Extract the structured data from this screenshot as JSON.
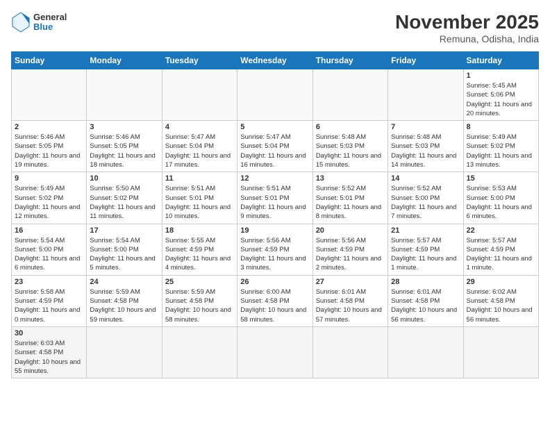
{
  "logo": {
    "general": "General",
    "blue": "Blue"
  },
  "title": "November 2025",
  "subtitle": "Remuna, Odisha, India",
  "days_of_week": [
    "Sunday",
    "Monday",
    "Tuesday",
    "Wednesday",
    "Thursday",
    "Friday",
    "Saturday"
  ],
  "weeks": [
    [
      {
        "day": "",
        "info": ""
      },
      {
        "day": "",
        "info": ""
      },
      {
        "day": "",
        "info": ""
      },
      {
        "day": "",
        "info": ""
      },
      {
        "day": "",
        "info": ""
      },
      {
        "day": "",
        "info": ""
      },
      {
        "day": "1",
        "info": "Sunrise: 5:45 AM\nSunset: 5:06 PM\nDaylight: 11 hours and 20 minutes."
      }
    ],
    [
      {
        "day": "2",
        "info": "Sunrise: 5:46 AM\nSunset: 5:05 PM\nDaylight: 11 hours and 19 minutes."
      },
      {
        "day": "3",
        "info": "Sunrise: 5:46 AM\nSunset: 5:05 PM\nDaylight: 11 hours and 18 minutes."
      },
      {
        "day": "4",
        "info": "Sunrise: 5:47 AM\nSunset: 5:04 PM\nDaylight: 11 hours and 17 minutes."
      },
      {
        "day": "5",
        "info": "Sunrise: 5:47 AM\nSunset: 5:04 PM\nDaylight: 11 hours and 16 minutes."
      },
      {
        "day": "6",
        "info": "Sunrise: 5:48 AM\nSunset: 5:03 PM\nDaylight: 11 hours and 15 minutes."
      },
      {
        "day": "7",
        "info": "Sunrise: 5:48 AM\nSunset: 5:03 PM\nDaylight: 11 hours and 14 minutes."
      },
      {
        "day": "8",
        "info": "Sunrise: 5:49 AM\nSunset: 5:02 PM\nDaylight: 11 hours and 13 minutes."
      }
    ],
    [
      {
        "day": "9",
        "info": "Sunrise: 5:49 AM\nSunset: 5:02 PM\nDaylight: 11 hours and 12 minutes."
      },
      {
        "day": "10",
        "info": "Sunrise: 5:50 AM\nSunset: 5:02 PM\nDaylight: 11 hours and 11 minutes."
      },
      {
        "day": "11",
        "info": "Sunrise: 5:51 AM\nSunset: 5:01 PM\nDaylight: 11 hours and 10 minutes."
      },
      {
        "day": "12",
        "info": "Sunrise: 5:51 AM\nSunset: 5:01 PM\nDaylight: 11 hours and 9 minutes."
      },
      {
        "day": "13",
        "info": "Sunrise: 5:52 AM\nSunset: 5:01 PM\nDaylight: 11 hours and 8 minutes."
      },
      {
        "day": "14",
        "info": "Sunrise: 5:52 AM\nSunset: 5:00 PM\nDaylight: 11 hours and 7 minutes."
      },
      {
        "day": "15",
        "info": "Sunrise: 5:53 AM\nSunset: 5:00 PM\nDaylight: 11 hours and 6 minutes."
      }
    ],
    [
      {
        "day": "16",
        "info": "Sunrise: 5:54 AM\nSunset: 5:00 PM\nDaylight: 11 hours and 6 minutes."
      },
      {
        "day": "17",
        "info": "Sunrise: 5:54 AM\nSunset: 5:00 PM\nDaylight: 11 hours and 5 minutes."
      },
      {
        "day": "18",
        "info": "Sunrise: 5:55 AM\nSunset: 4:59 PM\nDaylight: 11 hours and 4 minutes."
      },
      {
        "day": "19",
        "info": "Sunrise: 5:56 AM\nSunset: 4:59 PM\nDaylight: 11 hours and 3 minutes."
      },
      {
        "day": "20",
        "info": "Sunrise: 5:56 AM\nSunset: 4:59 PM\nDaylight: 11 hours and 2 minutes."
      },
      {
        "day": "21",
        "info": "Sunrise: 5:57 AM\nSunset: 4:59 PM\nDaylight: 11 hours and 1 minute."
      },
      {
        "day": "22",
        "info": "Sunrise: 5:57 AM\nSunset: 4:59 PM\nDaylight: 11 hours and 1 minute."
      }
    ],
    [
      {
        "day": "23",
        "info": "Sunrise: 5:58 AM\nSunset: 4:59 PM\nDaylight: 11 hours and 0 minutes."
      },
      {
        "day": "24",
        "info": "Sunrise: 5:59 AM\nSunset: 4:58 PM\nDaylight: 10 hours and 59 minutes."
      },
      {
        "day": "25",
        "info": "Sunrise: 5:59 AM\nSunset: 4:58 PM\nDaylight: 10 hours and 58 minutes."
      },
      {
        "day": "26",
        "info": "Sunrise: 6:00 AM\nSunset: 4:58 PM\nDaylight: 10 hours and 58 minutes."
      },
      {
        "day": "27",
        "info": "Sunrise: 6:01 AM\nSunset: 4:58 PM\nDaylight: 10 hours and 57 minutes."
      },
      {
        "day": "28",
        "info": "Sunrise: 6:01 AM\nSunset: 4:58 PM\nDaylight: 10 hours and 56 minutes."
      },
      {
        "day": "29",
        "info": "Sunrise: 6:02 AM\nSunset: 4:58 PM\nDaylight: 10 hours and 56 minutes."
      }
    ],
    [
      {
        "day": "30",
        "info": "Sunrise: 6:03 AM\nSunset: 4:58 PM\nDaylight: 10 hours and 55 minutes."
      },
      {
        "day": "",
        "info": ""
      },
      {
        "day": "",
        "info": ""
      },
      {
        "day": "",
        "info": ""
      },
      {
        "day": "",
        "info": ""
      },
      {
        "day": "",
        "info": ""
      },
      {
        "day": "",
        "info": ""
      }
    ]
  ]
}
